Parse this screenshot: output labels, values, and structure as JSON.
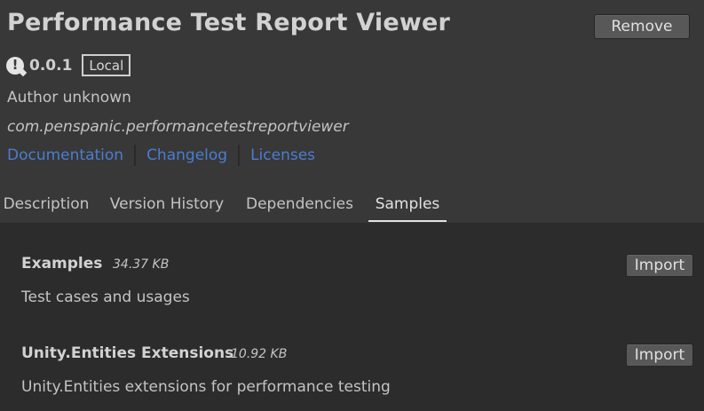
{
  "package": {
    "title": "Performance Test Report Viewer",
    "remove_label": "Remove",
    "version": "0.0.1",
    "source_badge": "Local",
    "author": "Author unknown",
    "name": "com.penspanic.performancetestreportviewer"
  },
  "links": {
    "documentation": "Documentation",
    "changelog": "Changelog",
    "licenses": "Licenses"
  },
  "tabs": [
    {
      "label": "Description"
    },
    {
      "label": "Version History"
    },
    {
      "label": "Dependencies"
    },
    {
      "label": "Samples",
      "active": true
    }
  ],
  "samples": [
    {
      "name": "Examples",
      "size": "34.37 KB",
      "description": "Test cases and usages",
      "import_label": "Import"
    },
    {
      "name": "Unity.Entities Extensions",
      "size": "10.92 KB",
      "description": "Unity.Entities extensions for performance testing",
      "import_label": "Import"
    }
  ],
  "colors": {
    "header_bg": "#383838",
    "content_bg": "#2c2c2d",
    "link": "#4c7dcf"
  },
  "icons": {
    "version_status": "warning-icon"
  }
}
